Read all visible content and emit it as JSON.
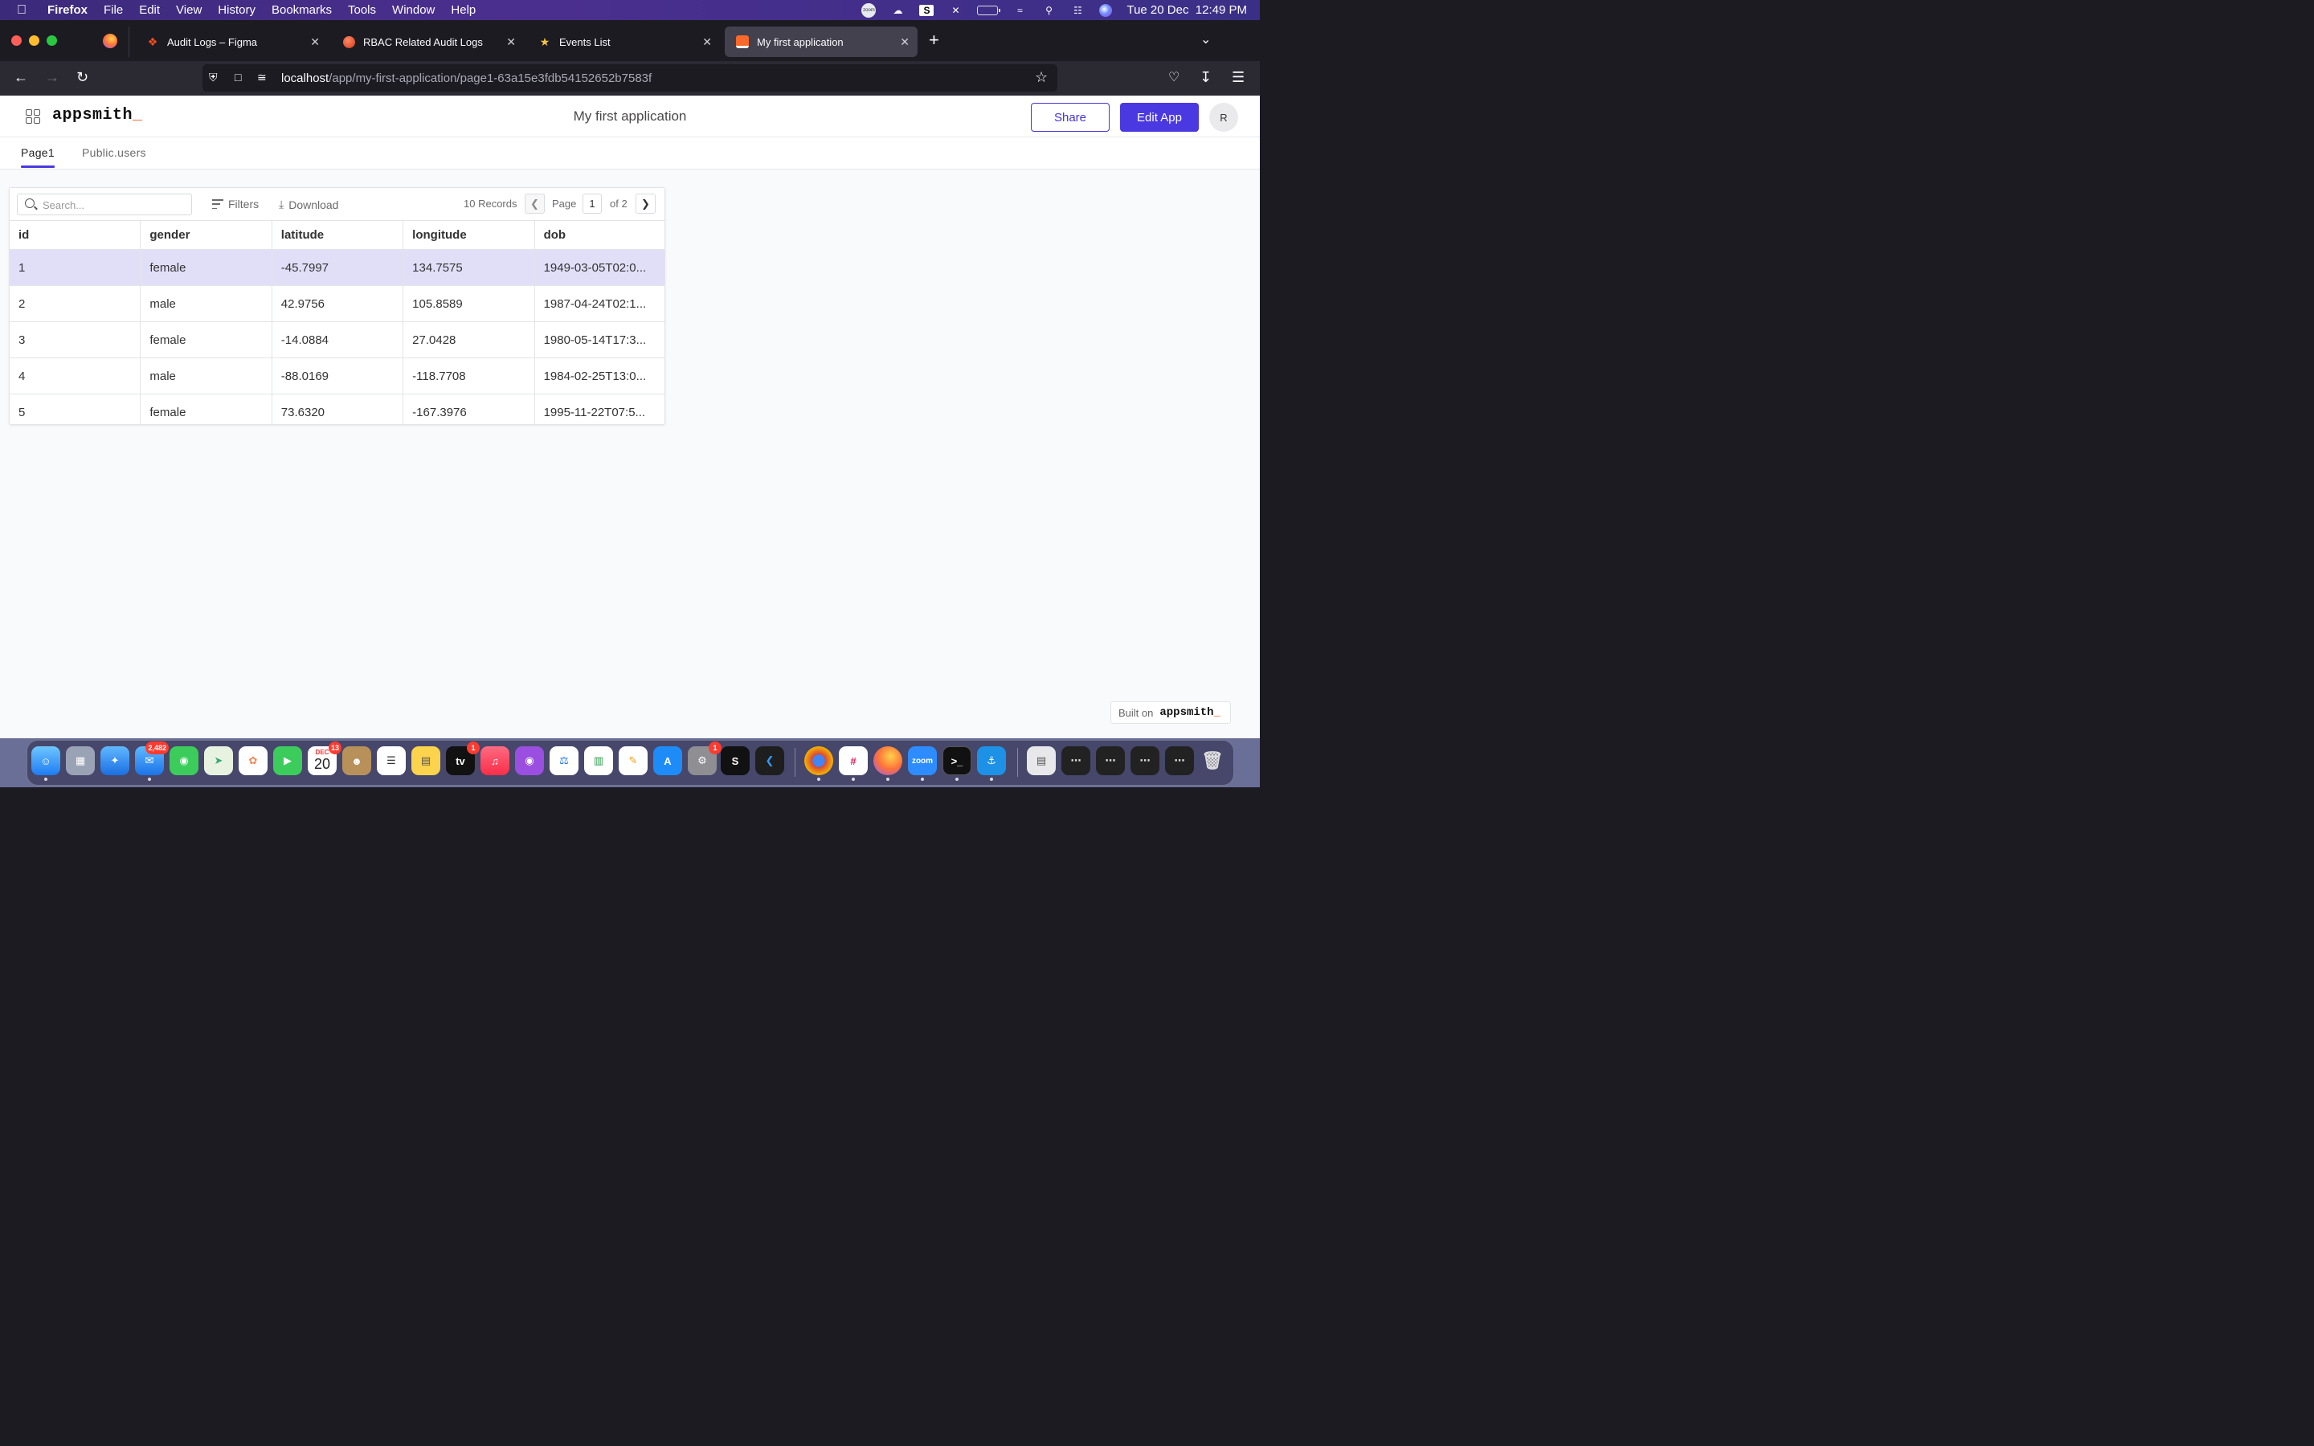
{
  "menubar": {
    "app_name": "Firefox",
    "items": [
      "File",
      "Edit",
      "View",
      "History",
      "Bookmarks",
      "Tools",
      "Window",
      "Help"
    ],
    "datetime": "Tue 20 Dec  12:49 PM"
  },
  "browser": {
    "tabs": [
      {
        "title": "Audit Logs – Figma",
        "icon": "figma-icon"
      },
      {
        "title": "RBAC Related Audit Logs",
        "icon": "red-circle-icon"
      },
      {
        "title": "Events List",
        "icon": "star-icon"
      },
      {
        "title": "My first application",
        "icon": "appsmith-icon",
        "active": true
      }
    ],
    "url_host": "localhost",
    "url_path": "/app/my-first-application/page1-63a15e3fdb54152652b7583f"
  },
  "app": {
    "logo": "appsmith",
    "logo_suffix": "_",
    "title": "My first application",
    "share_label": "Share",
    "edit_label": "Edit App",
    "avatar_initial": "R",
    "pages": [
      "Page1",
      "Public.users"
    ],
    "active_page": "Page1"
  },
  "table": {
    "search_placeholder": "Search...",
    "filters_label": "Filters",
    "download_label": "Download",
    "records_label": "10 Records",
    "page_label": "Page",
    "current_page": "1",
    "page_total_label": "of 2",
    "columns": [
      "id",
      "gender",
      "latitude",
      "longitude",
      "dob"
    ],
    "rows": [
      [
        "1",
        "female",
        "-45.7997",
        "134.7575",
        "1949-03-05T02:0..."
      ],
      [
        "2",
        "male",
        "42.9756",
        "105.8589",
        "1987-04-24T02:1..."
      ],
      [
        "3",
        "female",
        "-14.0884",
        "27.0428",
        "1980-05-14T17:3..."
      ],
      [
        "4",
        "male",
        "-88.0169",
        "-118.7708",
        "1984-02-25T13:0..."
      ],
      [
        "5",
        "female",
        "73.6320",
        "-167.3976",
        "1995-11-22T07:5..."
      ]
    ],
    "selected_row": 0
  },
  "built_on": {
    "label": "Built on",
    "logo": "appsmith",
    "logo_suffix": "_"
  },
  "dock": {
    "mail_badge": "2,482",
    "calendar_month": "DEC",
    "calendar_day": "20",
    "calendar_badge": "13",
    "tv_badge": "1",
    "settings_badge": "1",
    "zoom_label": "zoom"
  },
  "colors": {
    "accent": "#4a39e0",
    "selected_row": "#e1dff8",
    "logo_underscore": "#f86a2b"
  }
}
